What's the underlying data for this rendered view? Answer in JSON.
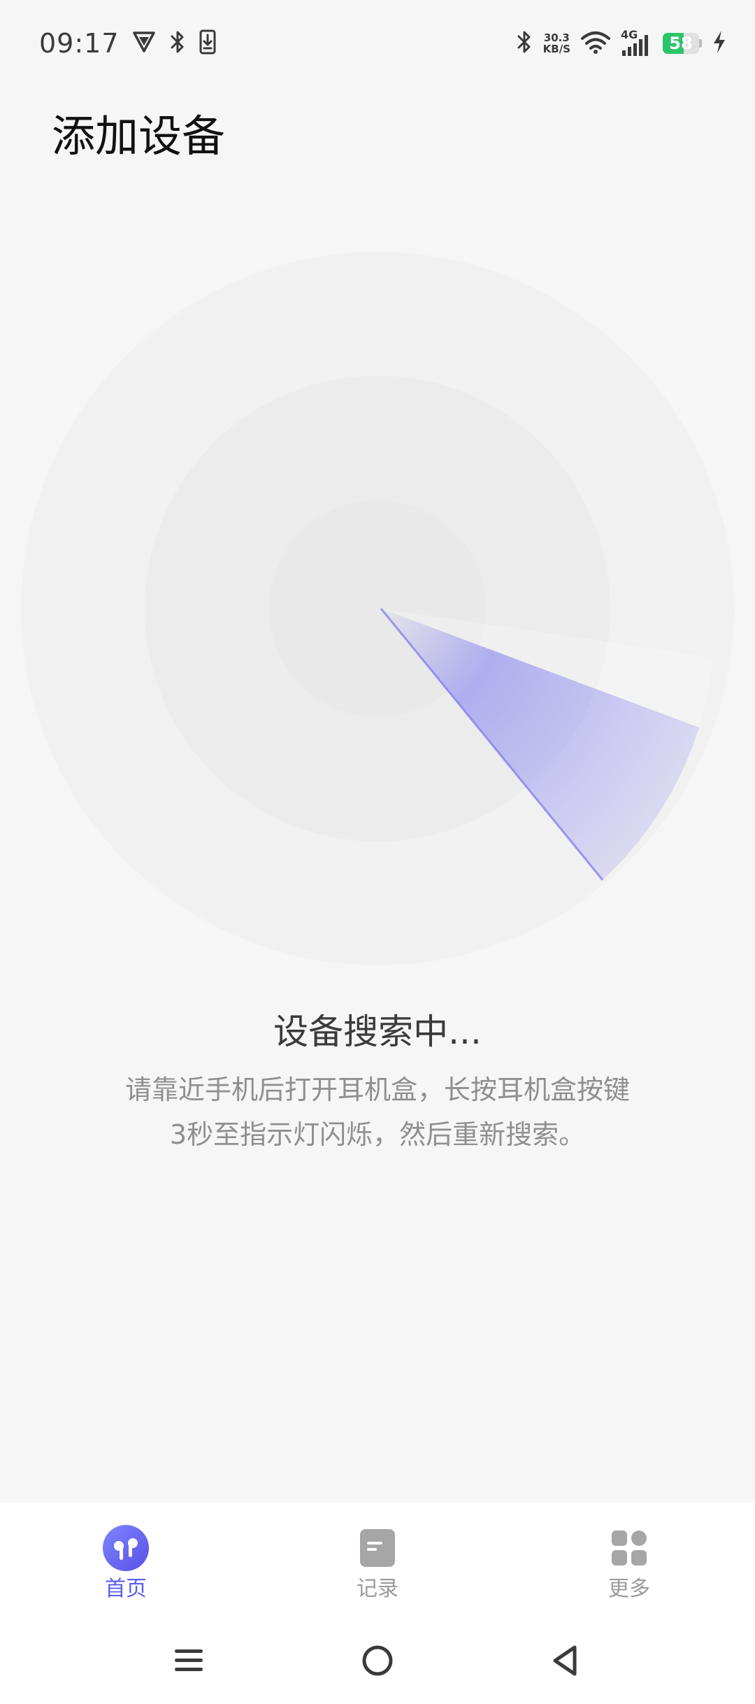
{
  "status_bar": {
    "time": "09:17",
    "net_speed_value": "30.3",
    "net_speed_unit": "KB/S",
    "network_type": "4G",
    "battery_level": "58",
    "battery_fraction": 0.58,
    "left_icons": [
      "vpn-shield-icon",
      "bluetooth-icon",
      "download-icon"
    ],
    "right_icons": [
      "bluetooth-icon",
      "wifi-icon",
      "signal-icon",
      "charging-icon"
    ]
  },
  "header": {
    "title": "添加设备"
  },
  "search": {
    "title": "设备搜索中...",
    "description_line1": "请靠近手机后打开耳机盒，长按耳机盒按键",
    "description_line2": "3秒至指示灯闪烁，然后重新搜索。"
  },
  "colors": {
    "accent": "#5a5cf0",
    "sweep": "#7f7bf2",
    "background": "#f6f6f6",
    "inactive": "#9a9a9a"
  },
  "bottom_nav": {
    "items": [
      {
        "label": "首页",
        "icon": "earbuds-icon",
        "active": true
      },
      {
        "label": "记录",
        "icon": "document-icon",
        "active": false
      },
      {
        "label": "更多",
        "icon": "grid-icon",
        "active": false
      }
    ]
  },
  "system_nav": {
    "buttons": [
      "menu-icon",
      "home-icon",
      "back-icon"
    ]
  }
}
